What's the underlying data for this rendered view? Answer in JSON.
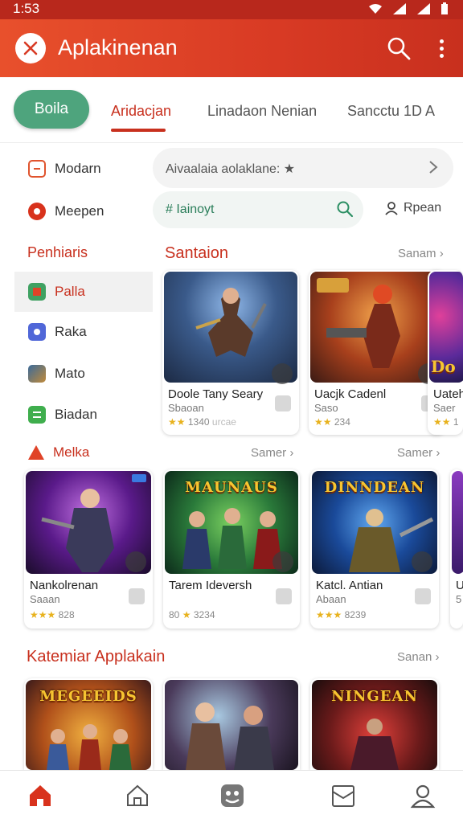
{
  "status_bar": {
    "time": "1:53"
  },
  "app_bar": {
    "title": "Aplakinenan"
  },
  "tabs": [
    {
      "label": "Boila"
    },
    {
      "label": "Aridacjan"
    },
    {
      "label": "Linadaon Nenian"
    },
    {
      "label": "Sancctu 1D A"
    }
  ],
  "sidebar": {
    "items_top": [
      {
        "label": "Modarn",
        "icon": "document-icon"
      },
      {
        "label": "Meepen",
        "icon": "message-icon"
      }
    ],
    "heading": "Penhiaris",
    "items": [
      {
        "label": "Palla",
        "icon": "bookmark-icon"
      },
      {
        "label": "Raka",
        "icon": "user-badge-icon"
      },
      {
        "label": "Mato",
        "icon": "image-icon"
      },
      {
        "label": "Biadan",
        "icon": "list-icon"
      }
    ]
  },
  "search": {
    "placeholder": "Aivaalaia aolaklane: ★"
  },
  "filter": {
    "value": "# Iainoyt",
    "person_label": "Rpean"
  },
  "section1": {
    "title": "Santaion",
    "more": "Sanam"
  },
  "row1": [
    {
      "name": "Doole Tany Seary",
      "sub": "Sbaoan",
      "rating": "1340",
      "extra": "urcae"
    },
    {
      "name": "Uacjk Cadenl",
      "sub": "Saso",
      "rating": "234",
      "extra": ""
    },
    {
      "name": "Uatehl",
      "sub": "Saer",
      "rating": "1",
      "extra": ""
    }
  ],
  "section2": {
    "title": "Melka",
    "more_a": "Samer",
    "more_b": "Samer"
  },
  "row2": [
    {
      "name": "Nankolrenan",
      "sub": "Saaan",
      "rating": "828",
      "prefix": ""
    },
    {
      "name": "Tarem Ideversh",
      "sub": "",
      "rating": "3234",
      "prefix": "80"
    },
    {
      "name": "Katcl. Antian",
      "sub": "Abaan",
      "rating": "8239",
      "prefix": ""
    },
    {
      "name": "U",
      "sub": "5",
      "rating": "",
      "prefix": ""
    }
  ],
  "section3": {
    "title": "Katemiar Applakain",
    "more": "Sanan"
  },
  "art_titles": {
    "r2c2": "MAUNAUS",
    "r2c3": "DINNDEAN",
    "r3c1": "MEGEEIDS",
    "r3c3": "NINGEAN",
    "r1c3": "Do"
  },
  "bottom_nav": [
    "home-icon",
    "home-outline-icon",
    "games-icon",
    "inbox-icon",
    "profile-icon"
  ],
  "colors": {
    "accent": "#c8301e",
    "appbar": "#d83a24",
    "pill": "#4ea47d",
    "star": "#e8b21d"
  }
}
